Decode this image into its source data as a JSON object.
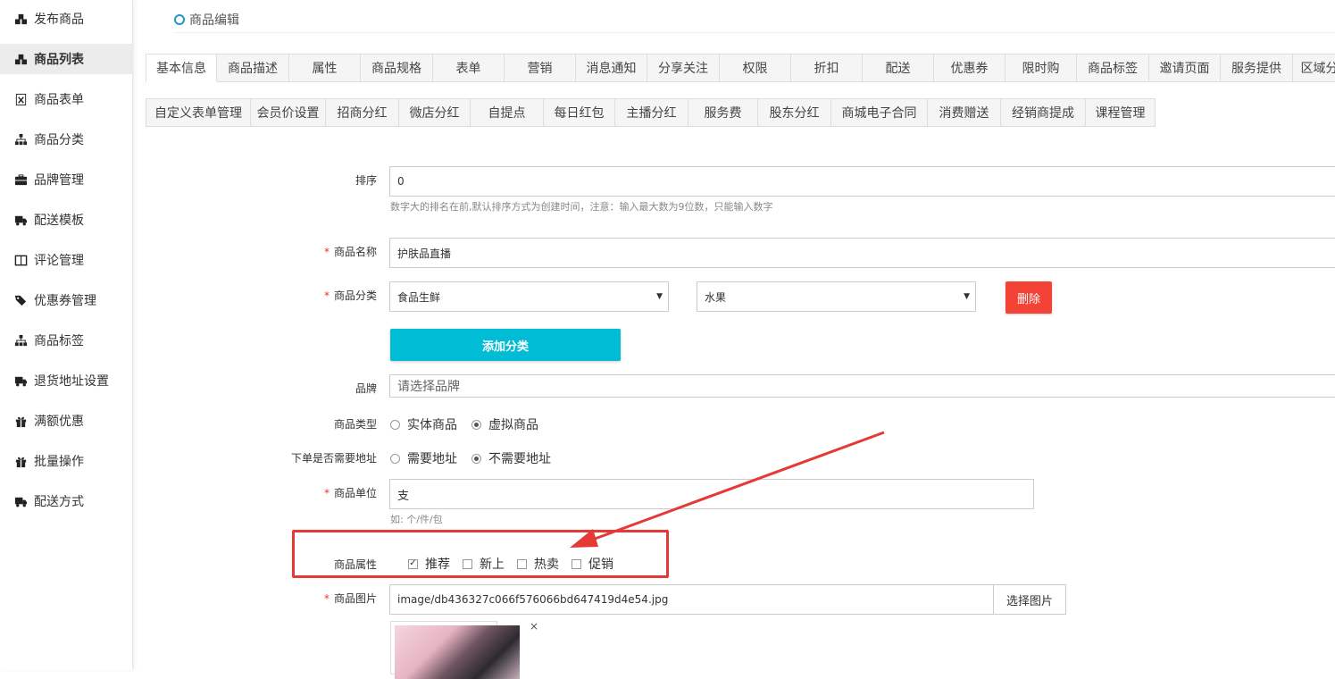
{
  "sidebar": {
    "items": [
      {
        "label": "发布商品",
        "icon": "cubes-icon"
      },
      {
        "label": "商品列表",
        "icon": "cubes-icon",
        "active": true
      },
      {
        "label": "商品表单",
        "icon": "excel-file-icon"
      },
      {
        "label": "商品分类",
        "icon": "sitemap-icon"
      },
      {
        "label": "品牌管理",
        "icon": "briefcase-icon"
      },
      {
        "label": "配送模板",
        "icon": "truck-icon"
      },
      {
        "label": "评论管理",
        "icon": "columns-icon"
      },
      {
        "label": "优惠券管理",
        "icon": "tags-icon"
      },
      {
        "label": "商品标签",
        "icon": "sitemap-icon"
      },
      {
        "label": "退货地址设置",
        "icon": "truck-icon"
      },
      {
        "label": "满额优惠",
        "icon": "gift-icon"
      },
      {
        "label": "批量操作",
        "icon": "gift-icon"
      },
      {
        "label": "配送方式",
        "icon": "truck-icon"
      }
    ]
  },
  "breadcrumb": {
    "title": "商品编辑"
  },
  "tabs_row1": [
    "基本信息",
    "商品描述",
    "属性",
    "商品规格",
    "表单",
    "营销",
    "消息通知",
    "分享关注",
    "权限",
    "折扣",
    "配送",
    "优惠券",
    "限时购",
    "商品标签",
    "邀请页面",
    "服务提供",
    "区域分"
  ],
  "tabs_row2": [
    "自定义表单管理",
    "会员价设置",
    "招商分红",
    "微店分红",
    "自提点",
    "每日红包",
    "主播分红",
    "服务费",
    "股东分红",
    "商城电子合同",
    "消费赠送",
    "经销商提成",
    "课程管理"
  ],
  "form": {
    "sort_label": "排序",
    "sort_value": "0",
    "sort_hint": "数字大的排名在前,默认排序方式为创建时间，注意：输入最大数为9位数，只能输入数字",
    "name_label": "商品名称",
    "name_value": "护肤品直播",
    "category_label": "商品分类",
    "category_1": "食品生鲜",
    "category_2": "水果",
    "delete_label": "删除",
    "add_category_label": "添加分类",
    "brand_label": "品牌",
    "brand_placeholder": "请选择品牌",
    "type_label": "商品类型",
    "type_options": [
      "实体商品",
      "虚拟商品"
    ],
    "address_label": "下单是否需要地址",
    "address_options": [
      "需要地址",
      "不需要地址"
    ],
    "unit_label": "商品单位",
    "unit_value": "支",
    "unit_hint": "如: 个/件/包",
    "attr_label": "商品属性",
    "attr_options": [
      {
        "label": "推荐",
        "checked": true
      },
      {
        "label": "新上",
        "checked": false
      },
      {
        "label": "热卖",
        "checked": false
      },
      {
        "label": "促销",
        "checked": false
      }
    ],
    "image_label": "商品图片",
    "image_value": "image/db436327c066f576066bd647419d4e54.jpg",
    "choose_image_label": "选择图片",
    "remove_symbol": "×"
  },
  "colors": {
    "accent_cyan": "#00bcd4",
    "danger": "#f44336",
    "annotation": "#e53935"
  }
}
